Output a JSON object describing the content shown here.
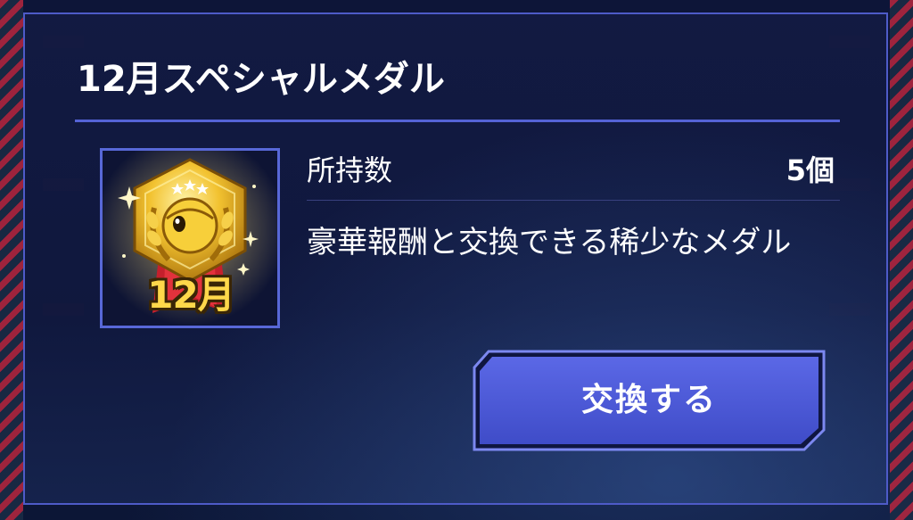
{
  "dialog": {
    "title": "12月スペシャルメダル"
  },
  "medal": {
    "icon": "december-medal-icon",
    "month_label": "12月"
  },
  "owned": {
    "label": "所持数",
    "count": "5個"
  },
  "description": "豪華報酬と交換できる稀少なメダル",
  "exchange_button": {
    "label": "交換する"
  },
  "colors": {
    "dialog_border": "#4e5bc8",
    "button_fill": "#4b58d6",
    "medal_gold": "#f2c230",
    "background": "#0b1030"
  }
}
